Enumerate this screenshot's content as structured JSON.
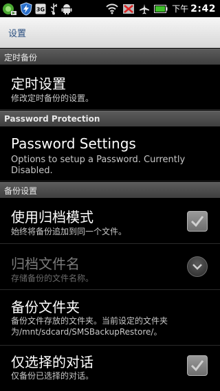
{
  "status_bar": {
    "icons": [
      "app-notify-icon",
      "lightning-shield-icon",
      "3g-icon",
      "usb-icon",
      "android-debug-icon",
      "wifi-icon",
      "signal-off-icon",
      "airplane-icon",
      "battery-icon"
    ],
    "network_label": "3G",
    "ampm": "下午",
    "time": "2:42"
  },
  "title_bar": {
    "title": "设置"
  },
  "sections": [
    {
      "header": "定时备份"
    },
    {
      "header": "Password Protection"
    },
    {
      "header": "备份设置"
    }
  ],
  "items": [
    {
      "title": "定时设置",
      "summary": "修改定时备份的设置。"
    },
    {
      "title": "Password Settings",
      "summary": "Options to setup a Password. Currently Disabled."
    },
    {
      "title": "使用归档模式",
      "summary": "始终将备份追加到同一个文件。",
      "control": "checkbox",
      "checked": true
    },
    {
      "title": "归档文件名",
      "summary": "存储备份的文件名称。",
      "control": "dropdown",
      "enabled": false
    },
    {
      "title": "备份文件夹",
      "summary": "备份文件存放的文件夹。当前设定的文件夹为/mnt/sdcard/SMSBackupRestore/。"
    },
    {
      "title": "仅选择的对话",
      "summary": "仅备份已选择的对话。",
      "control": "checkbox",
      "checked": true
    }
  ],
  "colors": {
    "title_bar_text": "#2a4f80",
    "section_header_bg": "#4a4a4a",
    "background": "#000000"
  }
}
